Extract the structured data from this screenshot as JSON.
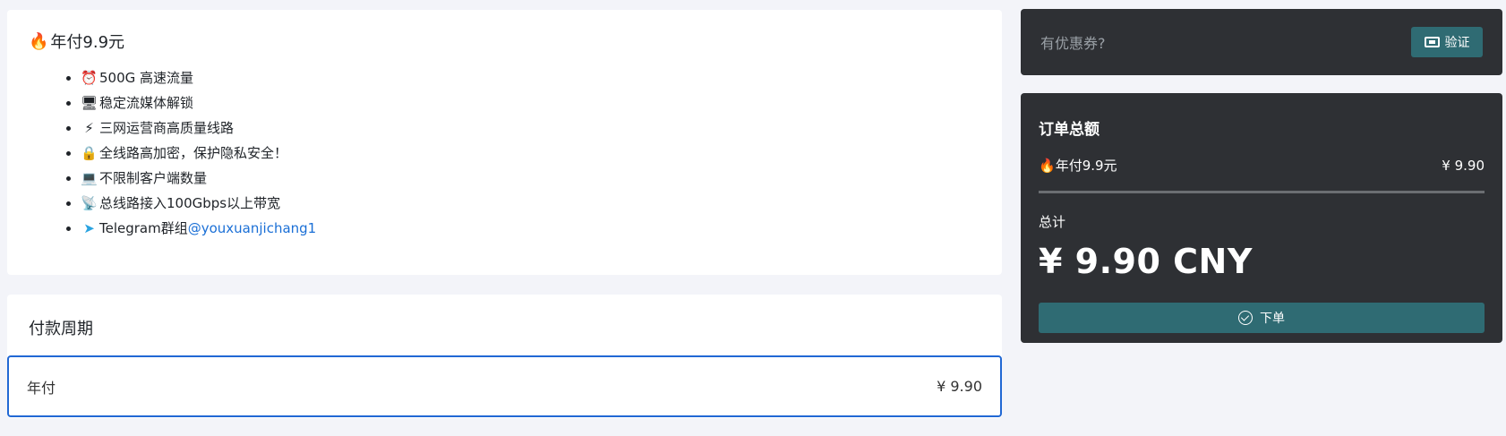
{
  "plan": {
    "title_emoji": "🔥",
    "title": "年付9.9元",
    "features": [
      {
        "icon": "⏰",
        "text": "500G 高速流量"
      },
      {
        "icon": "🖥",
        "text": "稳定流媒体解锁"
      },
      {
        "icon": "⚡",
        "text": "三网运营商高质量线路"
      },
      {
        "icon": "🔒",
        "text": "全线路高加密，保护隐私安全！"
      },
      {
        "icon": "💻",
        "text": "不限制客户端数量"
      },
      {
        "icon": "📡",
        "text": "总线路接入100Gbps以上带宽"
      },
      {
        "icon": "➤",
        "text": "Telegram群组",
        "link": "@youxuanjichang1"
      }
    ]
  },
  "period": {
    "title": "付款周期",
    "option_label": "年付",
    "option_price": "¥ 9.90"
  },
  "coupon": {
    "placeholder": "有优惠券?",
    "verify_label": "验证"
  },
  "order": {
    "title": "订单总额",
    "item_emoji": "🔥",
    "item_name": "年付9.9元",
    "item_price": "¥ 9.90",
    "total_label": "总计",
    "total_amount": "¥ 9.90 CNY",
    "submit_label": "下单"
  },
  "colors": {
    "accent": "#2168d4",
    "button": "#2f6b73",
    "dark_card": "#2e3034",
    "background": "#f3f4f9"
  }
}
